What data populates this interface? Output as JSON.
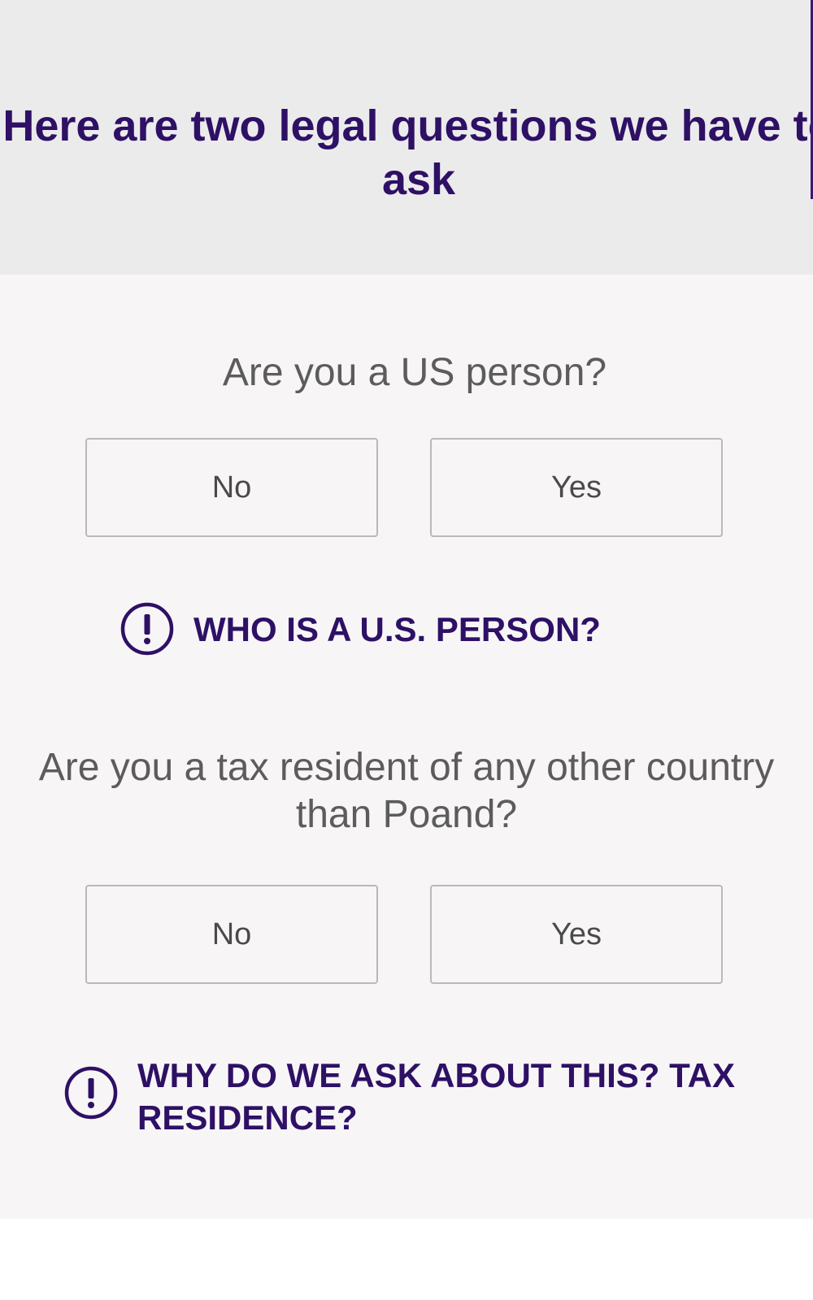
{
  "header": {
    "title": "Here are two legal questions we have to ask"
  },
  "questions": [
    {
      "text": "Are you a US person?",
      "options": {
        "no": "No",
        "yes": "Yes"
      },
      "info_link": "WHO IS A U.S. PERSON?"
    },
    {
      "text": "Are you a tax resident of any other country than Poand?",
      "options": {
        "no": "No",
        "yes": "Yes"
      },
      "info_link": "WHY DO WE ASK ABOUT THIS? TAX RESIDENCE?"
    }
  ],
  "icons": {
    "info": "exclamation-circle-icon"
  },
  "colors": {
    "brand_purple": "#2e1065",
    "question_text": "#5c5c5c",
    "header_bg": "#ebebec",
    "content_bg": "#f7f5f6",
    "button_border": "#b9b9bb"
  }
}
